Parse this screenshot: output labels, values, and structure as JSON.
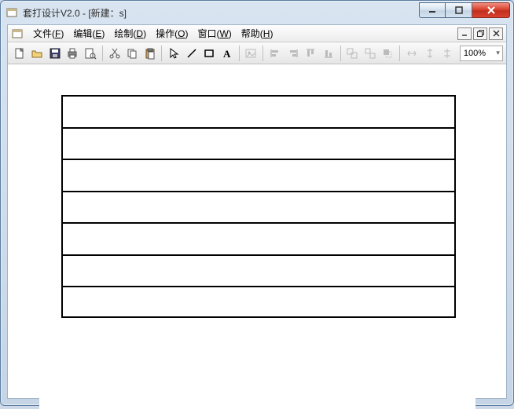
{
  "title": "套打设计V2.0 - [新建：s]",
  "menubar": {
    "items": [
      {
        "label": "文件",
        "accel": "F"
      },
      {
        "label": "编辑",
        "accel": "E"
      },
      {
        "label": "绘制",
        "accel": "D"
      },
      {
        "label": "操作",
        "accel": "O"
      },
      {
        "label": "窗口",
        "accel": "W"
      },
      {
        "label": "帮助",
        "accel": "H"
      }
    ]
  },
  "toolbar": {
    "zoom": "100%"
  },
  "table": {
    "rows": 7
  }
}
